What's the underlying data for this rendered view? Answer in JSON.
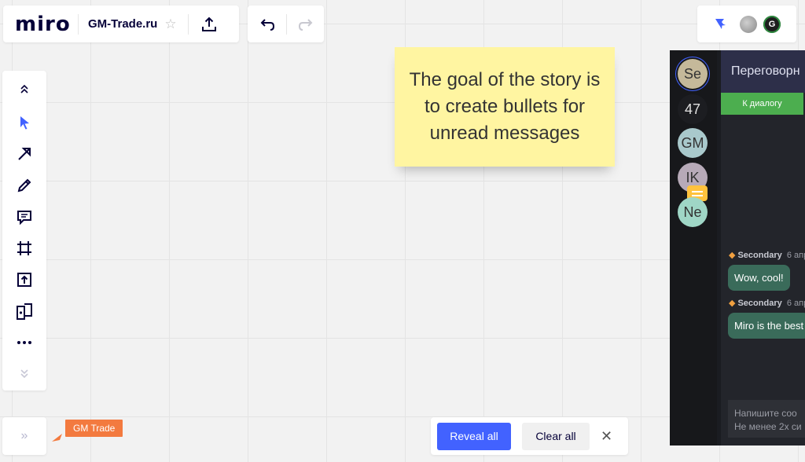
{
  "app": {
    "logo": "miro",
    "board_title": "GM-Trade.ru"
  },
  "toolbar": {
    "tools": [
      {
        "name": "collapse-up",
        "icon": "chevrons-up-icon"
      },
      {
        "name": "select",
        "icon": "arrow-cursor-icon"
      },
      {
        "name": "connection-line",
        "icon": "connector-arrow-icon"
      },
      {
        "name": "pen",
        "icon": "pen-icon"
      },
      {
        "name": "comment",
        "icon": "comment-icon"
      },
      {
        "name": "frame",
        "icon": "frame-icon"
      },
      {
        "name": "upload",
        "icon": "upload-icon"
      },
      {
        "name": "templates",
        "icon": "templates-icon"
      },
      {
        "name": "more",
        "icon": "more-dots-icon"
      },
      {
        "name": "collapse-down",
        "icon": "chevrons-down-icon"
      }
    ],
    "expand_icon": "»"
  },
  "collaborator": {
    "cursor_label": "GM Trade",
    "color": "#f37a3f"
  },
  "sticky_note": {
    "text": "The goal of the story is to create bullets for unread messages",
    "color": "#fff5a1"
  },
  "bottom_bar": {
    "reveal_label": "Reveal all",
    "clear_label": "Clear all",
    "close_label": "✕"
  },
  "chat": {
    "contacts": [
      {
        "initials": "Se",
        "color": "#c5b99a",
        "selected": true
      },
      {
        "initials": "47",
        "color": "#1c1d21"
      },
      {
        "initials": "GM",
        "color": "#a9c9cc"
      },
      {
        "initials": "IK",
        "color": "#b7aab8",
        "has_unread": true
      },
      {
        "initials": "Ne",
        "color": "#9fd6c6"
      }
    ],
    "header_title": "Переговорн",
    "dialog_button": "К диалогу",
    "messages": [
      {
        "sender": "Secondary",
        "date": "6 апр",
        "text": "Wow, cool!"
      },
      {
        "sender": "Secondary",
        "date": "6 апр",
        "text": "Miro is the best"
      }
    ],
    "input_placeholder_1": "Напишите соо",
    "input_placeholder_2": "Не менее 2х си"
  },
  "colors": {
    "accent": "#4262ff",
    "chat_button": "#4cae4f",
    "bubble": "#3a6b5a"
  }
}
